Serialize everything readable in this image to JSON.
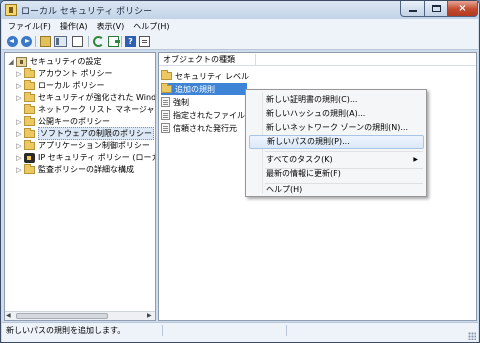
{
  "window": {
    "title": "ローカル セキュリティ ポリシー",
    "controls": {
      "minimize": "minimize",
      "maximize": "maximize",
      "close": "×"
    }
  },
  "menubar": [
    "ファイル(F)",
    "操作(A)",
    "表示(V)",
    "ヘルプ(H)"
  ],
  "toolbar": {
    "buttons": [
      "back-icon",
      "forward-icon",
      "up-icon",
      "show-tree-icon",
      "document-icon",
      "refresh-icon",
      "export-icon",
      "help-icon",
      "properties-icon"
    ],
    "help_glyph": "?"
  },
  "tree": {
    "items": [
      {
        "label": "セキュリティの設定",
        "expander": "◢"
      },
      {
        "label": "アカウント ポリシー",
        "expander": "▷"
      },
      {
        "label": "ローカル ポリシー",
        "expander": "▷"
      },
      {
        "label": "セキュリティが強化された Windows ファイアウォール",
        "expander": "▷"
      },
      {
        "label": "ネットワーク リスト マネージャー ポリシー",
        "expander": ""
      },
      {
        "label": "公開キーのポリシー",
        "expander": "▷"
      },
      {
        "label": "ソフトウェアの制限のポリシー",
        "expander": "▷"
      },
      {
        "label": "アプリケーション制御ポリシー",
        "expander": "▷"
      },
      {
        "label": "IP セキュリティ ポリシー (ローカル コンピューター)",
        "expander": "▷"
      },
      {
        "label": "監査ポリシーの詳細な構成",
        "expander": "▷"
      }
    ],
    "scroll_left": "◀",
    "scroll_right": "▶"
  },
  "list": {
    "column_header": "オブジェクトの種類",
    "items": [
      "セキュリティ レベル",
      "追加の規則",
      "強制",
      "指定されたファイルの種類",
      "信頼された発行元"
    ]
  },
  "context_menu": {
    "items": [
      "新しい証明書の規則(C)...",
      "新しいハッシュの規則(A)...",
      "新しいネットワーク ゾーンの規則(N)...",
      "新しいパスの規則(P)...",
      "すべてのタスク(K)",
      "最新の情報に更新(F)",
      "ヘルプ(H)"
    ],
    "submenu_arrow": "▶"
  },
  "statusbar": {
    "text": "新しいパスの規則を追加します。"
  },
  "colors": {
    "selection": "#3d84d6",
    "window_frame": "#cfdcec",
    "close_button": "#c24a2f"
  }
}
